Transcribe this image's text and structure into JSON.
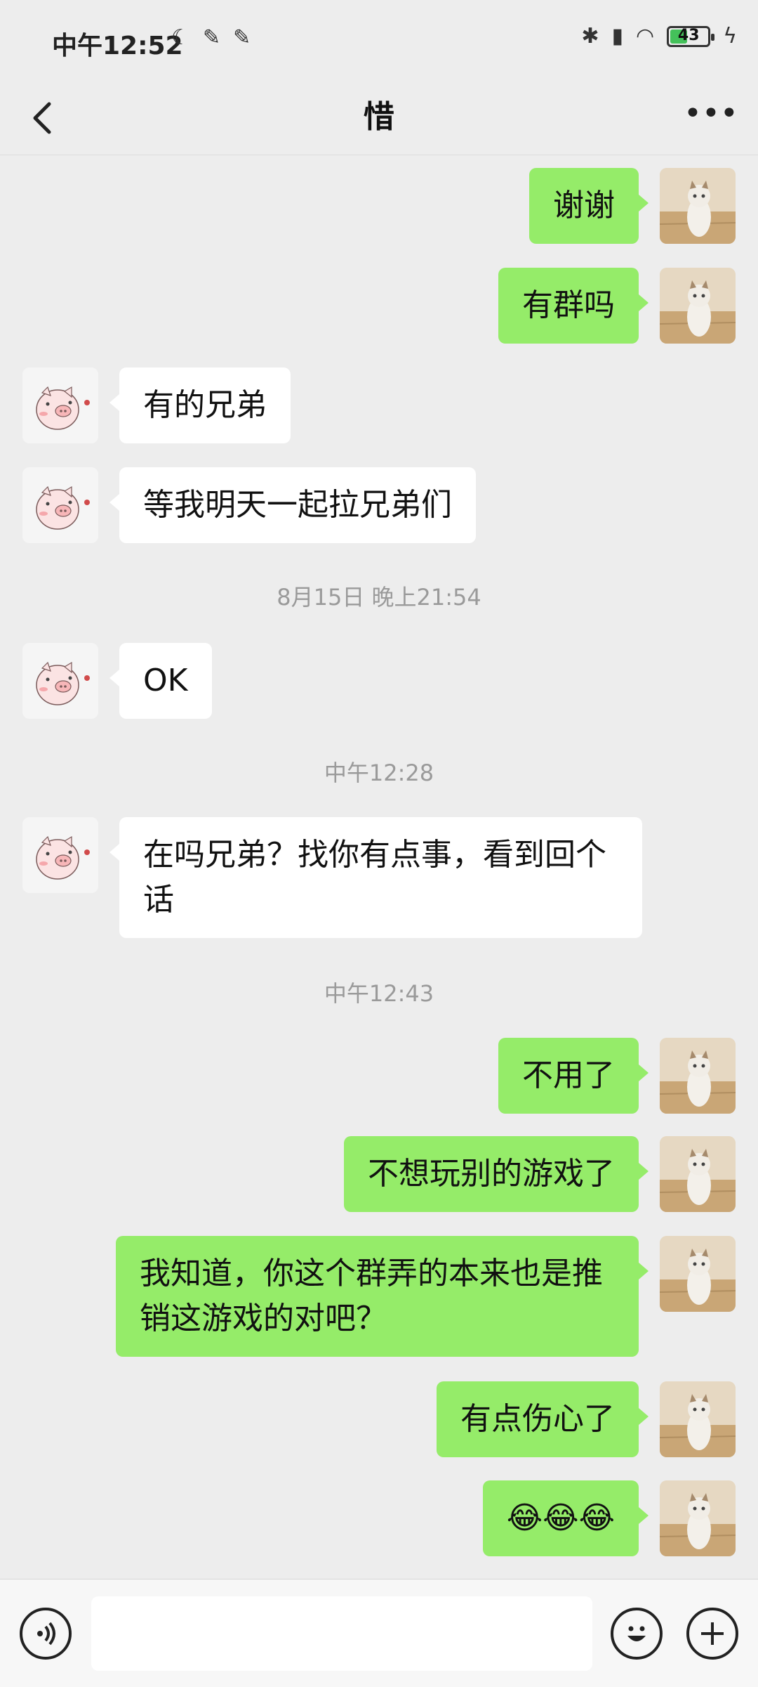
{
  "status_bar": {
    "time": "中午12:52",
    "battery": "43",
    "left_icons": [
      "moon-icon",
      "notification-icon",
      "notification-icon"
    ],
    "right_icons": [
      "bluetooth-icon",
      "hd-signal-icon",
      "wifi-icon",
      "battery-icon",
      "charging-icon"
    ]
  },
  "header": {
    "title": "惜"
  },
  "messages": [
    {
      "type": "msg",
      "side": "self",
      "text": "谢谢"
    },
    {
      "type": "msg",
      "side": "self",
      "text": "有群吗"
    },
    {
      "type": "msg",
      "side": "other",
      "text": "有的兄弟"
    },
    {
      "type": "msg",
      "side": "other",
      "text": "等我明天一起拉兄弟们"
    },
    {
      "type": "time",
      "text": "8月15日 晚上21:54"
    },
    {
      "type": "msg",
      "side": "other",
      "text": "OK"
    },
    {
      "type": "time",
      "text": "中午12:28"
    },
    {
      "type": "msg",
      "side": "other",
      "text": "在吗兄弟？找你有点事，看到回个话"
    },
    {
      "type": "time",
      "text": "中午12:43"
    },
    {
      "type": "msg",
      "side": "self",
      "text": "不用了"
    },
    {
      "type": "msg",
      "side": "self",
      "text": "不想玩别的游戏了"
    },
    {
      "type": "msg",
      "side": "self",
      "text": "我知道，你这个群弄的本来也是推销这游戏的对吧？"
    },
    {
      "type": "msg",
      "side": "self",
      "text": "有点伤心了"
    },
    {
      "type": "msg",
      "side": "self",
      "text": "😂😂😂"
    }
  ],
  "input": {
    "value": "",
    "placeholder": ""
  },
  "colors": {
    "self_bubble": "#95ec69",
    "other_bubble": "#ffffff",
    "background": "#ededed"
  }
}
